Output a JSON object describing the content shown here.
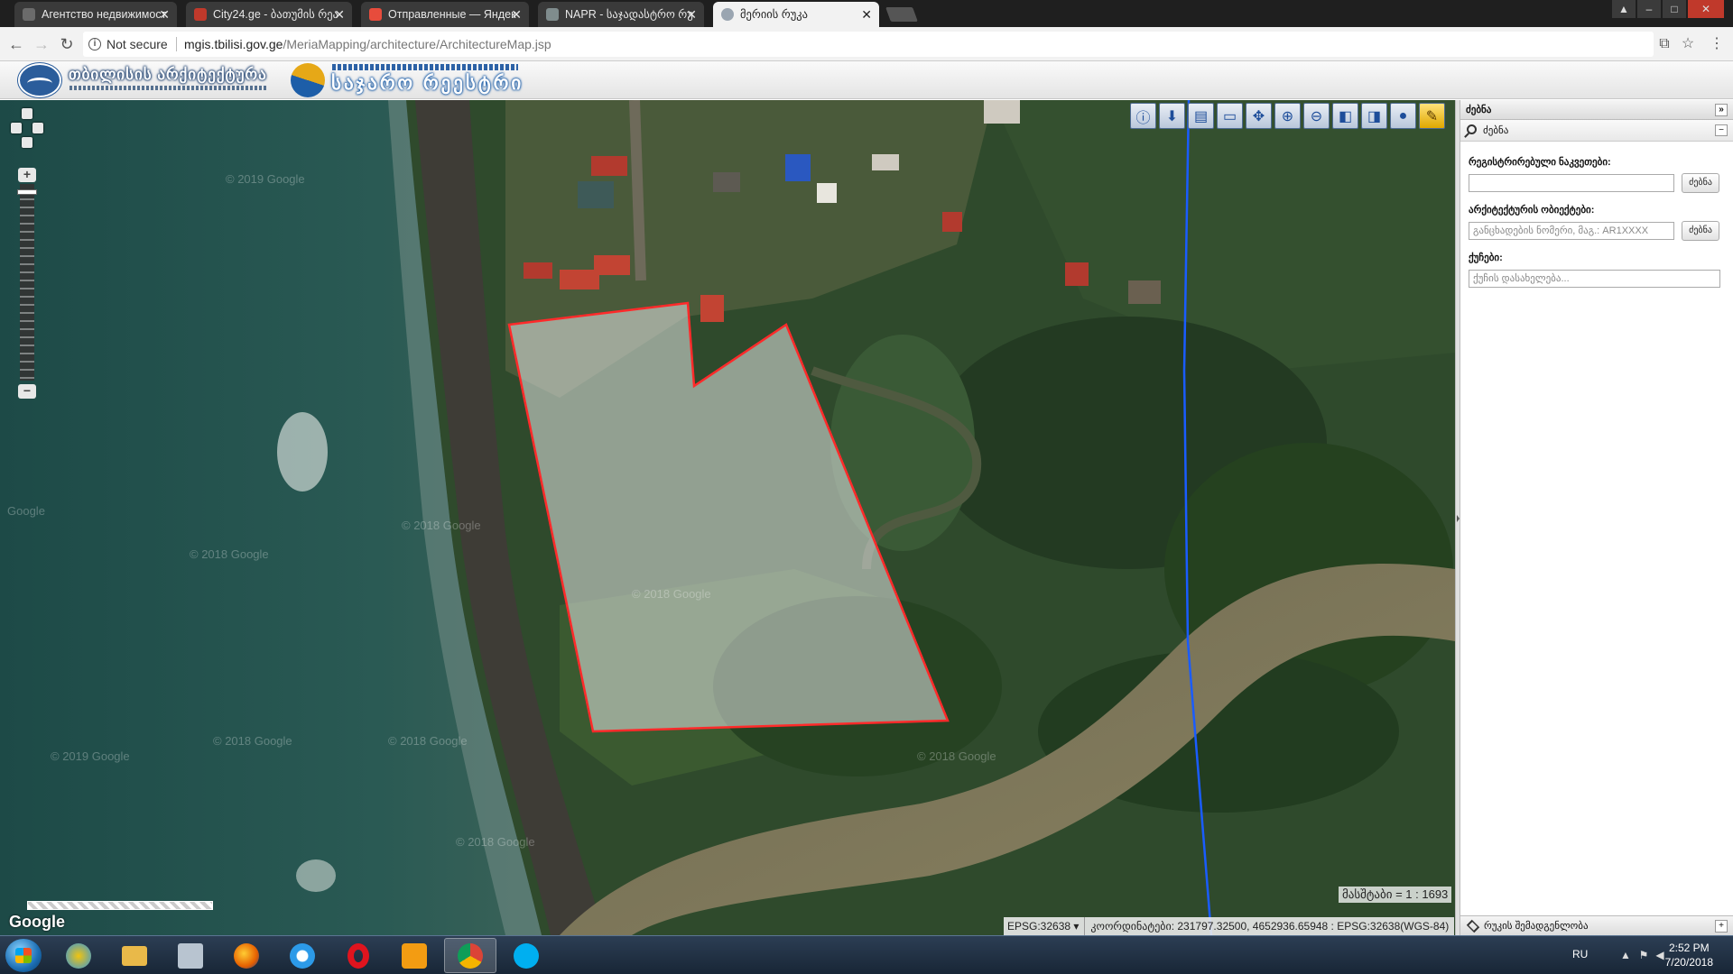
{
  "browser": {
    "tabs": [
      {
        "title": "Агентство недвижимост",
        "active": false,
        "favicon_color": "#6b6b6b"
      },
      {
        "title": "City24.ge - ბათუმის რეა",
        "active": false,
        "favicon_color": "#c0392b"
      },
      {
        "title": "Отправленные — Яндек",
        "active": false,
        "favicon_color": "#e74c3c"
      },
      {
        "title": "NAPR - საჯადასტრო რუ",
        "active": false,
        "favicon_color": "#7f8c8d"
      },
      {
        "title": "მერიის რუკა",
        "active": true,
        "favicon_color": "#9aa5b1"
      }
    ],
    "security_label": "Not secure",
    "url_host": "mgis.tbilisi.gov.ge",
    "url_path": "/MeriaMapping/architecture/ArchitectureMap.jsp"
  },
  "site": {
    "logo1_text": "თბილისის არქიტექტურა",
    "logo2_text": "სა​ჯარო რეესტრი"
  },
  "map": {
    "scale_label": "მასშტაბი = 1 : 1693",
    "projection": "EPSG:32638",
    "coordinates": "კოორდინატები: 231797.32500, 4652936.65948 : EPSG:32638(WGS-84)",
    "google_logo": "Google",
    "watermarks": [
      "© 2019 Google",
      "© 2018 Google",
      "© 2018 Google",
      "© 2018 Google",
      "© 2019 Google",
      "© 2018 Google",
      "© 2018 Google",
      "© 2018 Google",
      "© 2018 Google",
      "Google"
    ],
    "tools": [
      "info-icon",
      "identify-icon",
      "table-icon",
      "measure-icon",
      "pan-icon",
      "zoom-in-icon",
      "zoom-out-icon",
      "zoom-previous-icon",
      "zoom-next-icon",
      "globe-icon",
      "draw-icon"
    ],
    "parcel_outline_color": "#ff2a2a",
    "boundary_line_color": "#1a5cff"
  },
  "panel": {
    "title": "ძებნა",
    "section_title": "ძებნა",
    "cadastral_label": "რეგისტრირებული ნაკვეთები:",
    "cadastral_value": "",
    "arch_label": "არქიტექტურის ობიექტები:",
    "arch_placeholder": "განცხადების ნომერი, მაგ.: AR1XXXX",
    "streets_label": "ქუჩები:",
    "streets_placeholder": "ქუჩის დასახელება...",
    "search_button": "ძებნა",
    "footer_label": "რუკის შემადგენლობა"
  },
  "taskbar": {
    "language": "RU",
    "time": "2:52 PM",
    "date": "7/20/2018"
  }
}
